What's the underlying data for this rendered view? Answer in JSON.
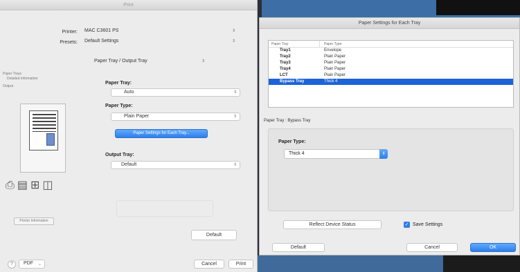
{
  "print_dialog": {
    "title": "Print",
    "printer_label": "Printer:",
    "printer_value": "MAC C3601 PS",
    "presets_label": "Presets:",
    "presets_value": "Default Settings",
    "panel_value": "Paper Tray / Output Tray",
    "paper_tray_label": "Paper Tray:",
    "paper_tray_value": "Auto",
    "paper_type_label": "Paper Type:",
    "paper_type_value": "Plain Paper",
    "paper_settings_button": "Paper Settings for Each Tray...",
    "output_tray_label": "Output Tray:",
    "output_tray_value": "Default",
    "sidebar_legend": [
      "Paper Trays",
      "Detailed information",
      "Output"
    ],
    "printer_information_button": "Printer Information",
    "default_button": "Default",
    "help_label": "?",
    "pdf_label": "PDF",
    "cancel_button": "Cancel",
    "print_button": "Print"
  },
  "paper_settings": {
    "title": "Paper Settings for Each Tray",
    "columns": [
      "Paper Tray",
      "Paper Type"
    ],
    "rows": [
      {
        "tray": "Tray1",
        "type": "Envelope"
      },
      {
        "tray": "Tray2",
        "type": "Plain Paper"
      },
      {
        "tray": "Tray3",
        "type": "Plain Paper"
      },
      {
        "tray": "Tray4",
        "type": "Plain Paper"
      },
      {
        "tray": "LCT",
        "type": "Plain Paper"
      },
      {
        "tray": "Bypass Tray",
        "type": "Thick 4"
      }
    ],
    "selected_row": 5,
    "section_label": "Paper Tray : Bypass Tray",
    "paper_type_label": "Paper Type:",
    "paper_type_value": "Thick 4",
    "reflect_button": "Reflect Device Status",
    "save_settings_label": "Save Settings",
    "default_button": "Default",
    "cancel_button": "Cancel",
    "ok_button": "OK"
  },
  "colors": {
    "accent": "#2f7fe6",
    "selection": "#1d63d8"
  }
}
